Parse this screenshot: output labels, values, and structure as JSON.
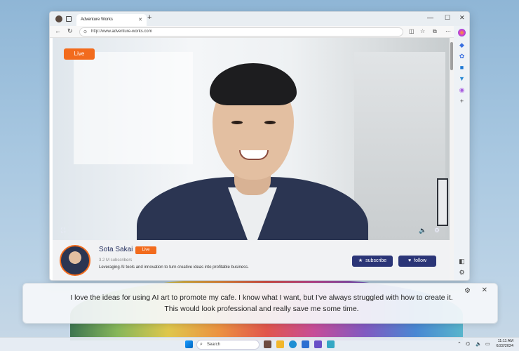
{
  "browser": {
    "tab_title": "Adventure Works",
    "url": "http://www.adventure-works.com"
  },
  "video": {
    "live_label": "Live"
  },
  "channel": {
    "name": "Sota Sakai",
    "live_badge": "Live",
    "subscribers": "3.2 M subscribers",
    "description": "Leveraging AI tools and innovation to turn creative ideas into profitable business.",
    "subscribe_label": "subscribe",
    "follow_label": "follow"
  },
  "caption": {
    "text": "I love the ideas for using AI art to promote my cafe. I know what I want, but I've always struggled with how to create it. This would look professional and really save me some time."
  },
  "taskbar": {
    "search_placeholder": "Search",
    "time": "11:11 AM",
    "date": "6/22/2024"
  },
  "colors": {
    "accent": "#f26b1d",
    "button": "#2b3577"
  }
}
